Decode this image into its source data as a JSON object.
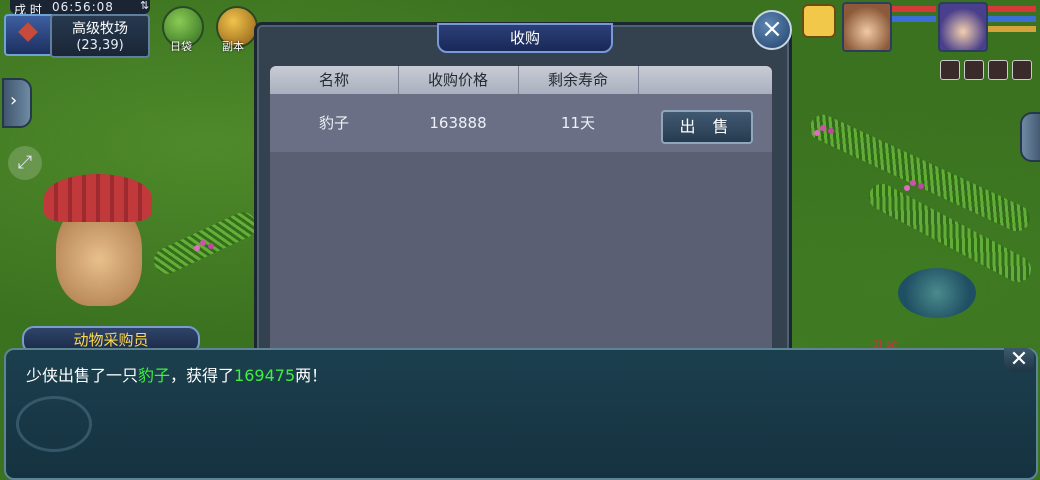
{
  "hud": {
    "shichen": "戌 时",
    "clock": "06:56:08",
    "location_name": "高级牧场",
    "coords": "(23,39)",
    "shortcut_bag": "日袋",
    "shortcut_dungeon": "副本"
  },
  "panel": {
    "title": "收购",
    "close_icon": "close-icon",
    "columns": [
      "名称",
      "收购价格",
      "剩余寿命",
      ""
    ],
    "rows": [
      {
        "name": "豹子",
        "price": "163888",
        "life": "11天",
        "action": "出 售"
      }
    ]
  },
  "npc": {
    "name": "动物采购员"
  },
  "dialog": {
    "prefix": "少侠出售了一只",
    "item": "豹子",
    "middle": "，获得了",
    "amount": "169475",
    "suffix": "两！"
  },
  "world": {
    "peacock_label": "孔雀"
  },
  "colors": {
    "accent_title": "#ffd84a",
    "highlight_green": "#3ff03f"
  }
}
